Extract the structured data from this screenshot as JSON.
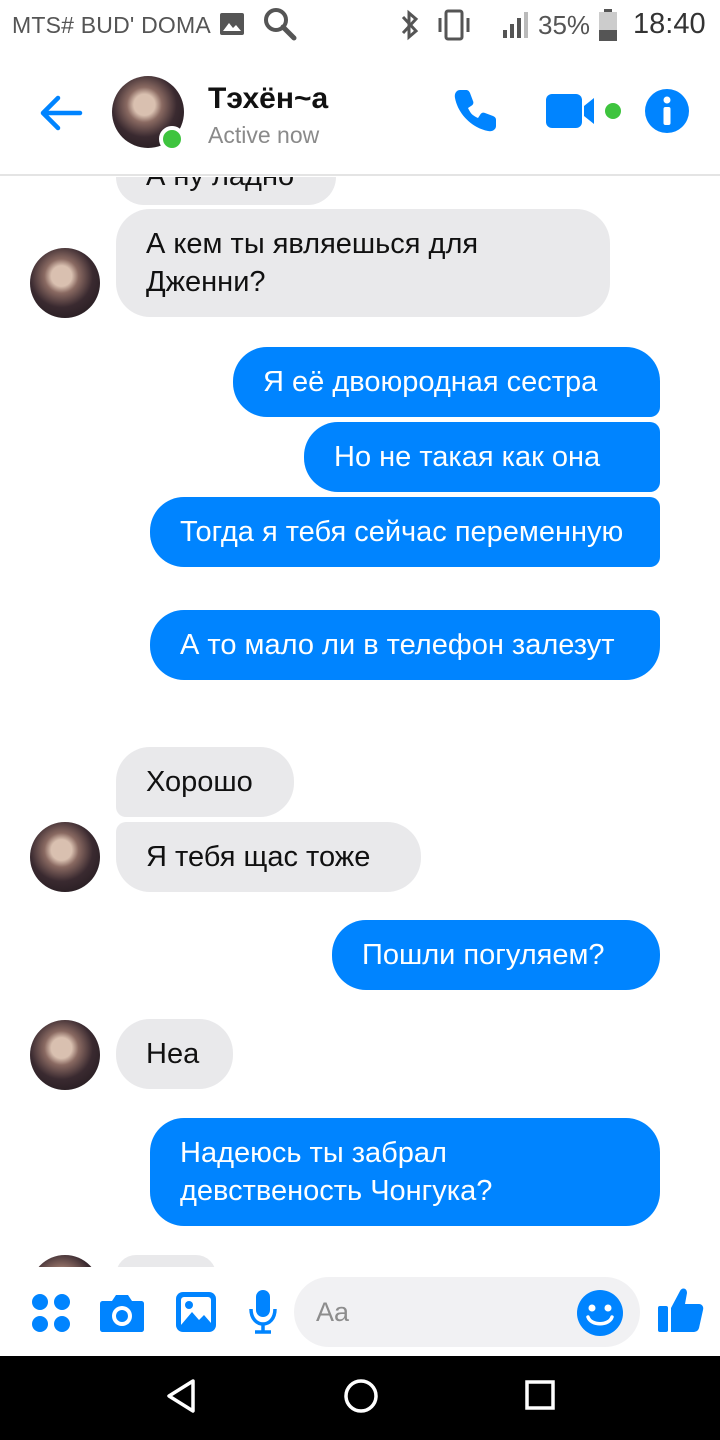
{
  "status_bar": {
    "carrier": "MTS# BUD' DOMA",
    "battery_percent": "35%",
    "time": "18:40",
    "icons": [
      "image-icon",
      "search-icon",
      "bluetooth-icon",
      "vibrate-icon",
      "signal-icon",
      "battery-icon"
    ]
  },
  "header": {
    "contact_name": "Тэхён~a",
    "status": "Active now",
    "buttons": [
      "back-icon",
      "phone-icon",
      "video-icon",
      "info-icon"
    ],
    "accent_color": "#0084ff"
  },
  "messages": [
    {
      "from": "them",
      "text": "А ну ладно"
    },
    {
      "from": "them",
      "text": "А кем ты являешься для Дженни?"
    },
    {
      "from": "me",
      "text": "Я её двоюродная сестра"
    },
    {
      "from": "me",
      "text": "Но не такая как она"
    },
    {
      "from": "me",
      "text": "Тогда я тебя сейчас переменную"
    },
    {
      "from": "me",
      "text": "А то мало ли в телефон залезут"
    },
    {
      "from": "them",
      "text": "Хорошо"
    },
    {
      "from": "them",
      "text": "Я тебя щас тоже"
    },
    {
      "from": "me",
      "text": "Пошли погуляем?"
    },
    {
      "from": "them",
      "text": "Неа"
    },
    {
      "from": "me",
      "text": "Надеюсь ты забрал девственость Чонгука?"
    }
  ],
  "composer": {
    "placeholder": "Aa",
    "icons": [
      "apps-icon",
      "camera-icon",
      "gallery-icon",
      "microphone-icon",
      "emoji-icon",
      "like-icon"
    ]
  },
  "navbar": {
    "icons": [
      "back-triangle-icon",
      "home-circle-icon",
      "recents-square-icon"
    ]
  },
  "colors": {
    "outgoing_bubble": "#0084ff",
    "incoming_bubble": "#e9e9eb",
    "online": "#3ec43e"
  }
}
